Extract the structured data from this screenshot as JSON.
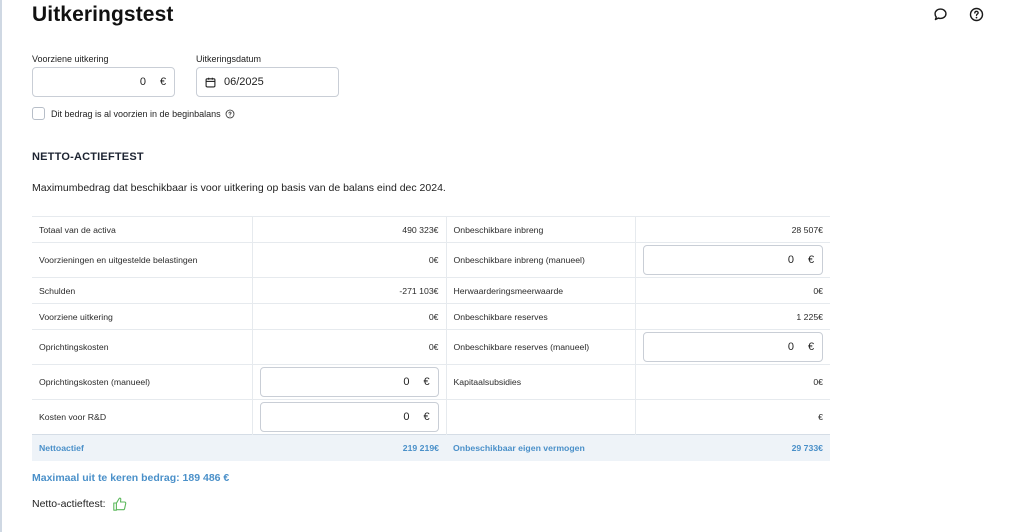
{
  "page": {
    "title": "Uitkeringstest",
    "icons": {
      "comment": "comment-icon",
      "help": "help-icon"
    }
  },
  "form": {
    "voorziene_uitkering": {
      "label": "Voorziene uitkering",
      "value": "0",
      "unit": "€"
    },
    "uitkeringsdatum": {
      "label": "Uitkeringsdatum",
      "value": "06/2025"
    },
    "beginbalans_checkbox": {
      "label": "Dit bedrag is al voorzien in de beginbalans",
      "checked": false
    }
  },
  "section": {
    "title": "NETTO-ACTIEFTEST",
    "intro": "Maximumbedrag dat beschikbaar is voor uitkering op basis van de balans eind dec 2024."
  },
  "table": {
    "rows": [
      {
        "left_label": "Totaal van de activa",
        "left_value": "490 323€",
        "right_label": "Onbeschikbare inbreng",
        "right_value": "28 507€"
      },
      {
        "left_label": "Voorzieningen en uitgestelde belastingen",
        "left_value": "0€",
        "right_label": "Onbeschikbare inbreng (manueel)",
        "right_input": {
          "value": "0",
          "unit": "€"
        }
      },
      {
        "left_label": "Schulden",
        "left_value": "-271 103€",
        "right_label": "Herwaarderingsmeerwaarde",
        "right_value": "0€"
      },
      {
        "left_label": "Voorziene uitkering",
        "left_value": "0€",
        "right_label": "Onbeschikbare reserves",
        "right_value": "1 225€"
      },
      {
        "left_label": "Oprichtingskosten",
        "left_value": "0€",
        "right_label": "Onbeschikbare reserves (manueel)",
        "right_input": {
          "value": "0",
          "unit": "€"
        }
      },
      {
        "left_label": "Oprichtingskosten (manueel)",
        "left_input": {
          "value": "0",
          "unit": "€"
        },
        "right_label": "Kapitaalsubsidies",
        "right_value": "0€"
      },
      {
        "left_label": "Kosten voor R&D",
        "left_input": {
          "value": "0",
          "unit": "€"
        },
        "right_label": "",
        "right_value": "€"
      }
    ],
    "total": {
      "left_label": "Nettoactief",
      "left_value": "219 219€",
      "right_label": "Onbeschikbaar eigen vermogen",
      "right_value": "29 733€"
    }
  },
  "summary": {
    "max_amount": "Maximaal uit te keren bedrag: 189 486 €",
    "test_label": "Netto-actieftest:",
    "test_result_icon": "thumbs-up-icon",
    "accent_color": "#4a90c9",
    "positive_color": "#5cb85c"
  }
}
